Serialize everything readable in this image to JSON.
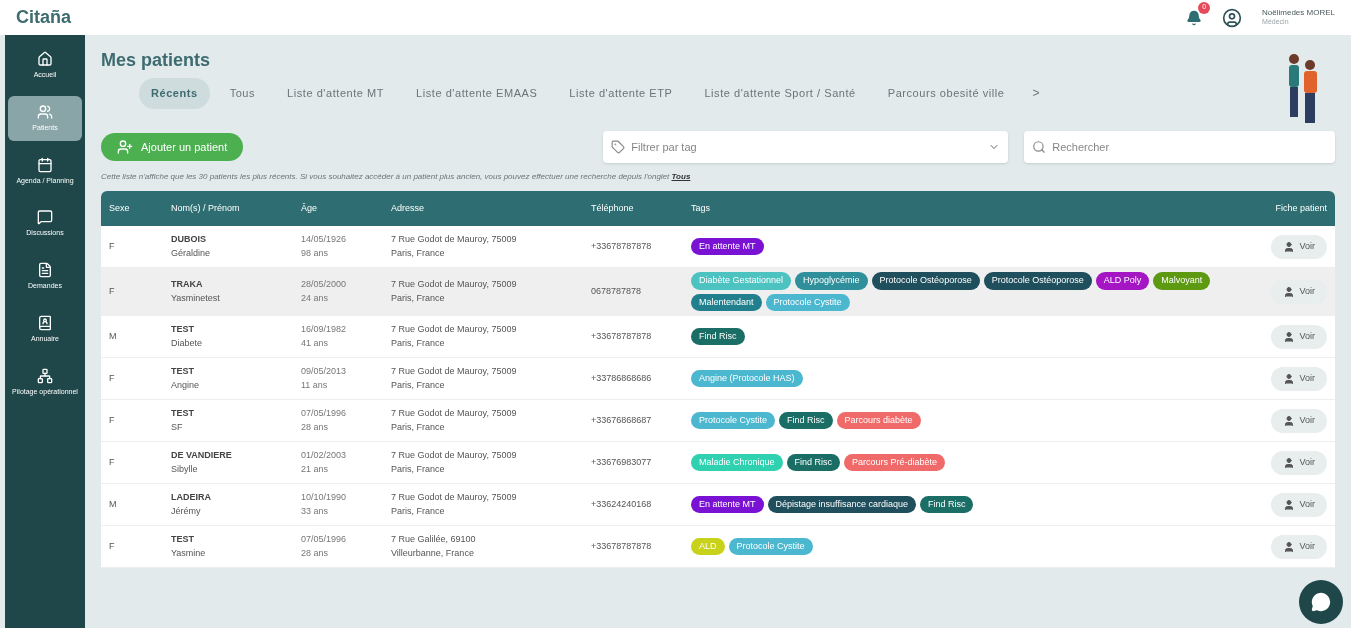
{
  "header": {
    "logo": "Citaña",
    "notification_badge": "0",
    "user": {
      "name": "Noëlimedes MOREL",
      "role": "Médecin"
    }
  },
  "sidebar": {
    "items": [
      {
        "label": "Accueil",
        "selected": false
      },
      {
        "label": "Patients",
        "selected": true
      },
      {
        "label": "Agenda / Planning",
        "selected": false
      },
      {
        "label": "Discussions",
        "selected": false
      },
      {
        "label": "Demandes",
        "selected": false
      },
      {
        "label": "Annuaire",
        "selected": false
      },
      {
        "label": "Pilotage opérationnel",
        "selected": false
      }
    ]
  },
  "page": {
    "title": "Mes patients",
    "tabs": [
      {
        "label": "Récents",
        "selected": true
      },
      {
        "label": "Tous",
        "selected": false
      },
      {
        "label": "Liste d'attente MT",
        "selected": false
      },
      {
        "label": "Liste d'attente EMAAS",
        "selected": false
      },
      {
        "label": "Liste d'attente ETP",
        "selected": false
      },
      {
        "label": "Liste d'attente Sport / Santé",
        "selected": false
      },
      {
        "label": "Parcours obesité ville",
        "selected": false
      }
    ],
    "tabs_next": ">",
    "add_button": "Ajouter un patient",
    "tag_filter": {
      "placeholder": "Filtrer par tag"
    },
    "search": {
      "placeholder": "Rechercher"
    },
    "notice": "Cette liste n'affiche que les 30 patients les plus récents. Si vous souhaitez accéder à un patient plus ancien, vous pouvez effectuer une recherche depuis l'onglet",
    "notice_link": "Tous"
  },
  "table": {
    "columns": [
      "Sexe",
      "Nom(s) / Prénom",
      "Âge",
      "Adresse",
      "Téléphone",
      "Tags",
      "Fiche patient"
    ],
    "rows": [
      {
        "sexe": "F",
        "nom": "DUBOIS",
        "prenom": "Géraldine",
        "date": "14/05/1926",
        "age": "98 ans",
        "adresse1": "7 Rue Godot de Mauroy, 75009",
        "adresse2": "Paris, France",
        "telephone": "+33678787878",
        "selected": false,
        "tags": [
          {
            "label": "En attente MT",
            "color": "#7a12d4"
          }
        ],
        "action": "Voir"
      },
      {
        "sexe": "F",
        "nom": "TRAKA",
        "prenom": "Yasminetest",
        "date": "28/05/2000",
        "age": "24 ans",
        "adresse1": "7 Rue Godot de Mauroy, 75009",
        "adresse2": "Paris, France",
        "telephone": "0678787878",
        "selected": true,
        "tags": [
          {
            "label": "Diabète Gestationnel",
            "color": "#4cc3c0"
          },
          {
            "label": "Hypoglycémie",
            "color": "#2f8f9a"
          },
          {
            "label": "Protocole Ostéoporose",
            "color": "#1f4f5c"
          },
          {
            "label": "Protocole Ostéoporose",
            "color": "#1f4f5c"
          },
          {
            "label": "ALD Poly",
            "color": "#a415c4"
          },
          {
            "label": "Malvoyant",
            "color": "#5d9a12"
          },
          {
            "label": "Malentendant",
            "color": "#22808e"
          },
          {
            "label": "Protocole Cystite",
            "color": "#4cb8d0"
          }
        ],
        "action": "Voir"
      },
      {
        "sexe": "M",
        "nom": "TEST",
        "prenom": "Diabete",
        "date": "16/09/1982",
        "age": "41 ans",
        "adresse1": "7 Rue Godot de Mauroy, 75009",
        "adresse2": "Paris, France",
        "telephone": "+33678787878",
        "selected": false,
        "tags": [
          {
            "label": "Find Risc",
            "color": "#1b6e66"
          }
        ],
        "action": "Voir"
      },
      {
        "sexe": "F",
        "nom": "TEST",
        "prenom": "Angine",
        "date": "09/05/2013",
        "age": "11 ans",
        "adresse1": "7 Rue Godot de Mauroy, 75009",
        "adresse2": "Paris, France",
        "telephone": "+33786868686",
        "selected": false,
        "tags": [
          {
            "label": "Angine (Protocole HAS)",
            "color": "#4cb8d0"
          }
        ],
        "action": "Voir"
      },
      {
        "sexe": "F",
        "nom": "TEST",
        "prenom": "SF",
        "date": "07/05/1996",
        "age": "28 ans",
        "adresse1": "7 Rue Godot de Mauroy, 75009",
        "adresse2": "Paris, France",
        "telephone": "+33676868687",
        "selected": false,
        "tags": [
          {
            "label": "Protocole Cystite",
            "color": "#4cb8d0"
          },
          {
            "label": "Find Risc",
            "color": "#1b6e66"
          },
          {
            "label": "Parcours diabète",
            "color": "#f06a6a"
          }
        ],
        "action": "Voir"
      },
      {
        "sexe": "F",
        "nom": "DE VANDIERE",
        "prenom": "Sibylle",
        "date": "01/02/2003",
        "age": "21 ans",
        "adresse1": "7 Rue Godot de Mauroy, 75009",
        "adresse2": "Paris, France",
        "telephone": "+33676983077",
        "selected": false,
        "tags": [
          {
            "label": "Maladie Chronique",
            "color": "#2fd1b0"
          },
          {
            "label": "Find Risc",
            "color": "#1b6e66"
          },
          {
            "label": "Parcours Pré-diabète",
            "color": "#f06a6a"
          }
        ],
        "action": "Voir"
      },
      {
        "sexe": "M",
        "nom": "LADEIRA",
        "prenom": "Jérémy",
        "date": "10/10/1990",
        "age": "33 ans",
        "adresse1": "7 Rue Godot de Mauroy, 75009",
        "adresse2": "Paris, France",
        "telephone": "+33624240168",
        "selected": false,
        "tags": [
          {
            "label": "En attente MT",
            "color": "#7a12d4"
          },
          {
            "label": "Dépistage insuffisance cardiaque",
            "color": "#1f4f5c"
          },
          {
            "label": "Find Risc",
            "color": "#1b6e66"
          }
        ],
        "action": "Voir"
      },
      {
        "sexe": "F",
        "nom": "TEST",
        "prenom": "Yasmine",
        "date": "07/05/1996",
        "age": "28 ans",
        "adresse1": "7 Rue Galilée, 69100",
        "adresse2": "Villeurbanne, France",
        "telephone": "+33678787878",
        "selected": false,
        "tags": [
          {
            "label": "ALD",
            "color": "#c9d21a"
          },
          {
            "label": "Protocole Cystite",
            "color": "#4cb8d0"
          }
        ],
        "action": "Voir"
      }
    ]
  }
}
